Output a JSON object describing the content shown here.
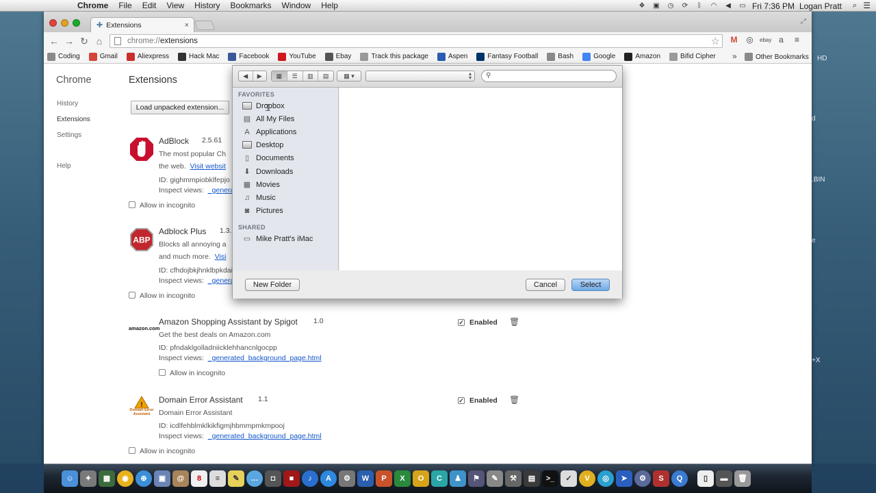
{
  "menubar": {
    "items": [
      "Chrome",
      "File",
      "Edit",
      "View",
      "History",
      "Bookmarks",
      "Window",
      "Help"
    ],
    "clock": "Fri 7:36 PM",
    "user": "Logan Pratt"
  },
  "browser": {
    "tab_title": "Extensions",
    "url_scheme": "chrome://",
    "url_path": "extensions",
    "bookmarks": [
      {
        "label": "Coding",
        "icon": "folder-icon",
        "color": "#8a8a8a"
      },
      {
        "label": "Gmail",
        "icon": "gmail-icon",
        "color": "#d44638"
      },
      {
        "label": "Aliexpress",
        "icon": "aliexpress-icon",
        "color": "#c9302c"
      },
      {
        "label": "Hack Mac",
        "icon": "hack-mac-icon",
        "color": "#333333"
      },
      {
        "label": "Facebook",
        "icon": "facebook-icon",
        "color": "#3b5998"
      },
      {
        "label": "YouTube",
        "icon": "youtube-icon",
        "color": "#cc181e"
      },
      {
        "label": "Ebay",
        "icon": "ebay-icon",
        "color": "#555555"
      },
      {
        "label": "Track this package",
        "icon": "page-icon",
        "color": "#9a9a9a"
      },
      {
        "label": "Aspen",
        "icon": "aspen-icon",
        "color": "#2a5db0"
      },
      {
        "label": "Fantasy Football",
        "icon": "nfl-icon",
        "color": "#013369"
      },
      {
        "label": "Bash",
        "icon": "folder-icon",
        "color": "#8a8a8a"
      },
      {
        "label": "Google",
        "icon": "google-icon",
        "color": "#4285f4"
      },
      {
        "label": "Amazon",
        "icon": "amazon-icon",
        "color": "#222222"
      },
      {
        "label": "Bifid Cipher",
        "icon": "page-icon",
        "color": "#9a9a9a"
      }
    ],
    "other_bookmarks": "Other Bookmarks"
  },
  "sidebar": {
    "title": "Chrome",
    "items": [
      "History",
      "Extensions",
      "Settings",
      "Help"
    ]
  },
  "main": {
    "title": "Extensions",
    "load_button": "Load unpacked extension...",
    "extensions": [
      {
        "name": "AdBlock",
        "version": "2.5.61",
        "desc1": "The most popular Ch",
        "desc2": "the web.",
        "link": "Visit websit",
        "id": "ID: gighmmpiobklfepjo",
        "inspect": "Inspect views:",
        "inspect_link": "_genera",
        "incognito": "Allow in incognito",
        "enabled": "",
        "icon": "adblock-hand-icon"
      },
      {
        "name": "Adblock Plus",
        "version": "1.3.",
        "desc1": "Blocks all annoying a",
        "desc2": "and much more.",
        "link": "Visi",
        "id": "ID: cfhdojbkjhnklbpkdai",
        "inspect": "Inspect views:",
        "inspect_link": "_genera",
        "incognito": "Allow in incognito",
        "enabled": "",
        "icon": "abp-stop-sign-icon",
        "icon_text": "ABP"
      },
      {
        "name": "Amazon Shopping Assistant by Spigot",
        "version": "1.0",
        "desc1": "Get the best deals on Amazon.com",
        "desc2": "",
        "link": "",
        "id": "ID: pfndaklgolladniicklehhancnlgocpp",
        "inspect": "Inspect views:",
        "inspect_link": "_generated_background_page.html",
        "incognito": "Allow in incognito",
        "enabled": "Enabled",
        "icon": "amazon-logo-icon",
        "icon_text": "amazon.com"
      },
      {
        "name": "Domain Error Assistant",
        "version": "1.1",
        "desc1": "Domain Error Assistant",
        "desc2": "",
        "link": "",
        "id": "ID: icdlfehblmklkikfigmjhbmmpmkmpooj",
        "inspect": "Inspect views:",
        "inspect_link": "_generated_background_page.html",
        "incognito": "Allow in incognito",
        "enabled": "Enabled",
        "icon": "domain-error-warning-icon",
        "icon_text": "Domain Error Assistant"
      }
    ]
  },
  "dialog": {
    "favorites_header": "FAVORITES",
    "favorites": [
      {
        "label": "Dropbox",
        "icon": "dropbox-folder-icon"
      },
      {
        "label": "All My Files",
        "icon": "all-files-icon"
      },
      {
        "label": "Applications",
        "icon": "applications-icon"
      },
      {
        "label": "Desktop",
        "icon": "desktop-icon"
      },
      {
        "label": "Documents",
        "icon": "documents-icon"
      },
      {
        "label": "Downloads",
        "icon": "downloads-icon"
      },
      {
        "label": "Movies",
        "icon": "movies-icon"
      },
      {
        "label": "Music",
        "icon": "music-icon"
      },
      {
        "label": "Pictures",
        "icon": "pictures-icon"
      }
    ],
    "shared_header": "SHARED",
    "shared": [
      {
        "label": "Mike Pratt's iMac",
        "icon": "imac-icon"
      }
    ],
    "new_folder": "New Folder",
    "cancel": "Cancel",
    "select": "Select"
  },
  "desktop": {
    "fragments": [
      "HD",
      "d",
      ".BIN",
      "e",
      "+X"
    ]
  },
  "colors": {
    "link": "#1155cc",
    "select_button": "#6ea9e6",
    "adblock_red": "#c8102e",
    "abp_red": "#c1272d"
  }
}
